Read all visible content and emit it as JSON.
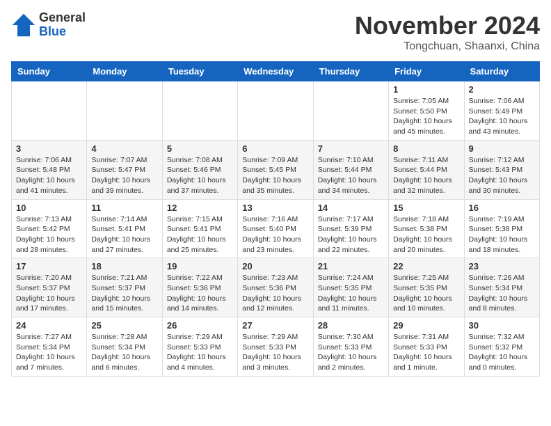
{
  "header": {
    "logo_general": "General",
    "logo_blue": "Blue",
    "month_title": "November 2024",
    "location": "Tongchuan, Shaanxi, China"
  },
  "days_of_week": [
    "Sunday",
    "Monday",
    "Tuesday",
    "Wednesday",
    "Thursday",
    "Friday",
    "Saturday"
  ],
  "weeks": [
    {
      "days": [
        {
          "num": "",
          "info": ""
        },
        {
          "num": "",
          "info": ""
        },
        {
          "num": "",
          "info": ""
        },
        {
          "num": "",
          "info": ""
        },
        {
          "num": "",
          "info": ""
        },
        {
          "num": "1",
          "info": "Sunrise: 7:05 AM\nSunset: 5:50 PM\nDaylight: 10 hours and 45 minutes."
        },
        {
          "num": "2",
          "info": "Sunrise: 7:06 AM\nSunset: 5:49 PM\nDaylight: 10 hours and 43 minutes."
        }
      ]
    },
    {
      "days": [
        {
          "num": "3",
          "info": "Sunrise: 7:06 AM\nSunset: 5:48 PM\nDaylight: 10 hours and 41 minutes."
        },
        {
          "num": "4",
          "info": "Sunrise: 7:07 AM\nSunset: 5:47 PM\nDaylight: 10 hours and 39 minutes."
        },
        {
          "num": "5",
          "info": "Sunrise: 7:08 AM\nSunset: 5:46 PM\nDaylight: 10 hours and 37 minutes."
        },
        {
          "num": "6",
          "info": "Sunrise: 7:09 AM\nSunset: 5:45 PM\nDaylight: 10 hours and 35 minutes."
        },
        {
          "num": "7",
          "info": "Sunrise: 7:10 AM\nSunset: 5:44 PM\nDaylight: 10 hours and 34 minutes."
        },
        {
          "num": "8",
          "info": "Sunrise: 7:11 AM\nSunset: 5:44 PM\nDaylight: 10 hours and 32 minutes."
        },
        {
          "num": "9",
          "info": "Sunrise: 7:12 AM\nSunset: 5:43 PM\nDaylight: 10 hours and 30 minutes."
        }
      ]
    },
    {
      "days": [
        {
          "num": "10",
          "info": "Sunrise: 7:13 AM\nSunset: 5:42 PM\nDaylight: 10 hours and 28 minutes."
        },
        {
          "num": "11",
          "info": "Sunrise: 7:14 AM\nSunset: 5:41 PM\nDaylight: 10 hours and 27 minutes."
        },
        {
          "num": "12",
          "info": "Sunrise: 7:15 AM\nSunset: 5:41 PM\nDaylight: 10 hours and 25 minutes."
        },
        {
          "num": "13",
          "info": "Sunrise: 7:16 AM\nSunset: 5:40 PM\nDaylight: 10 hours and 23 minutes."
        },
        {
          "num": "14",
          "info": "Sunrise: 7:17 AM\nSunset: 5:39 PM\nDaylight: 10 hours and 22 minutes."
        },
        {
          "num": "15",
          "info": "Sunrise: 7:18 AM\nSunset: 5:38 PM\nDaylight: 10 hours and 20 minutes."
        },
        {
          "num": "16",
          "info": "Sunrise: 7:19 AM\nSunset: 5:38 PM\nDaylight: 10 hours and 18 minutes."
        }
      ]
    },
    {
      "days": [
        {
          "num": "17",
          "info": "Sunrise: 7:20 AM\nSunset: 5:37 PM\nDaylight: 10 hours and 17 minutes."
        },
        {
          "num": "18",
          "info": "Sunrise: 7:21 AM\nSunset: 5:37 PM\nDaylight: 10 hours and 15 minutes."
        },
        {
          "num": "19",
          "info": "Sunrise: 7:22 AM\nSunset: 5:36 PM\nDaylight: 10 hours and 14 minutes."
        },
        {
          "num": "20",
          "info": "Sunrise: 7:23 AM\nSunset: 5:36 PM\nDaylight: 10 hours and 12 minutes."
        },
        {
          "num": "21",
          "info": "Sunrise: 7:24 AM\nSunset: 5:35 PM\nDaylight: 10 hours and 11 minutes."
        },
        {
          "num": "22",
          "info": "Sunrise: 7:25 AM\nSunset: 5:35 PM\nDaylight: 10 hours and 10 minutes."
        },
        {
          "num": "23",
          "info": "Sunrise: 7:26 AM\nSunset: 5:34 PM\nDaylight: 10 hours and 8 minutes."
        }
      ]
    },
    {
      "days": [
        {
          "num": "24",
          "info": "Sunrise: 7:27 AM\nSunset: 5:34 PM\nDaylight: 10 hours and 7 minutes."
        },
        {
          "num": "25",
          "info": "Sunrise: 7:28 AM\nSunset: 5:34 PM\nDaylight: 10 hours and 6 minutes."
        },
        {
          "num": "26",
          "info": "Sunrise: 7:29 AM\nSunset: 5:33 PM\nDaylight: 10 hours and 4 minutes."
        },
        {
          "num": "27",
          "info": "Sunrise: 7:29 AM\nSunset: 5:33 PM\nDaylight: 10 hours and 3 minutes."
        },
        {
          "num": "28",
          "info": "Sunrise: 7:30 AM\nSunset: 5:33 PM\nDaylight: 10 hours and 2 minutes."
        },
        {
          "num": "29",
          "info": "Sunrise: 7:31 AM\nSunset: 5:33 PM\nDaylight: 10 hours and 1 minute."
        },
        {
          "num": "30",
          "info": "Sunrise: 7:32 AM\nSunset: 5:32 PM\nDaylight: 10 hours and 0 minutes."
        }
      ]
    }
  ]
}
